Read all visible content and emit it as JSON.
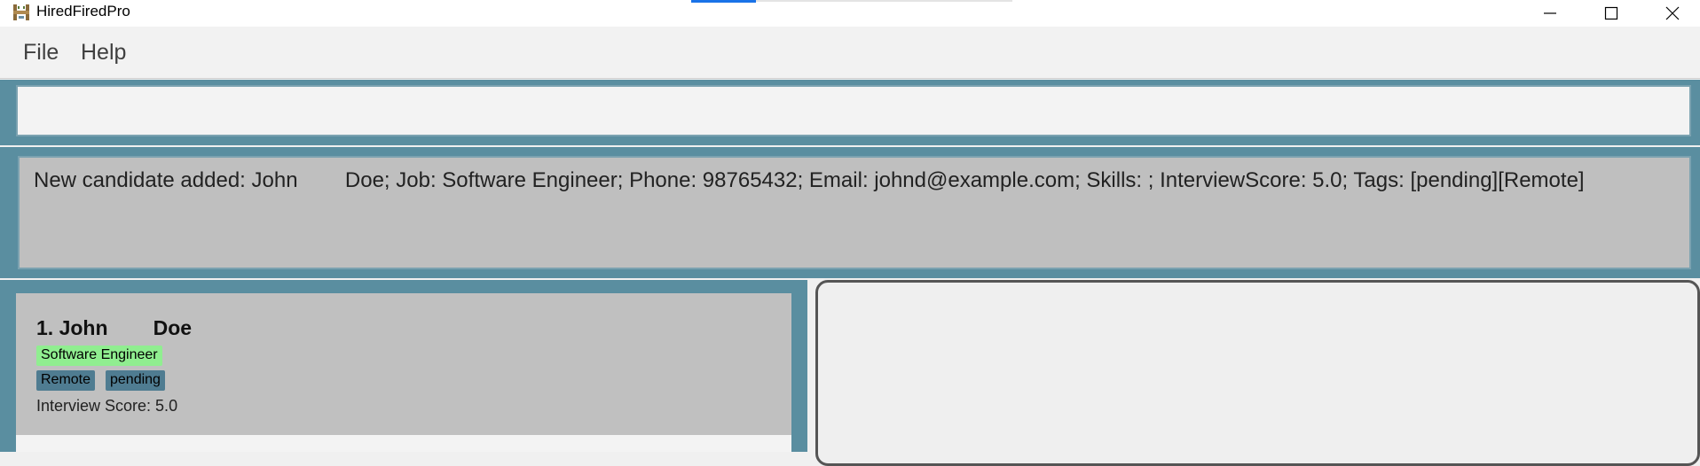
{
  "window": {
    "title": "HiredFiredPro",
    "icon": "app-logo-icon",
    "controls": [
      "minimize-icon",
      "maximize-icon",
      "close-icon"
    ]
  },
  "menu": {
    "file": "File",
    "help": "Help"
  },
  "command_box": {
    "value": ""
  },
  "result": {
    "message": "New candidate added: John        Doe; Job: Software Engineer; Phone: 98765432; Email: johnd@example.com; Skills: ; InterviewScore: 5.0; Tags: [pending][Remote]"
  },
  "candidates": [
    {
      "index_name": "1. John        Doe",
      "job": "Software Engineer",
      "tags": [
        "Remote",
        "pending"
      ],
      "score": "Interview Score: 5.0"
    }
  ],
  "colors": {
    "frame_teal": "#5a8ea0",
    "job_chip": "#90ee90",
    "tag_chip": "#4f7c91",
    "card_bg": "#c0c0c0"
  }
}
